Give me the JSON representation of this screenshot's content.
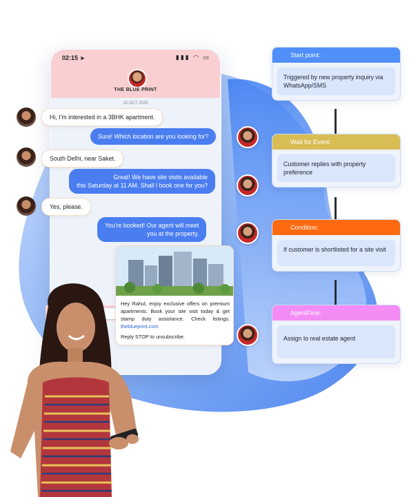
{
  "phone": {
    "time": "02:15",
    "brand": "THE BLUE PRINT",
    "date": "02 OCT 2025",
    "input_placeholder": "ssage"
  },
  "messages": [
    {
      "from": "customer",
      "text": "Hi, I'm interested in a 3BHK apartment."
    },
    {
      "from": "agent",
      "text": "Sure! Which location are you looking for?"
    },
    {
      "from": "customer",
      "text": "South Delhi, near Saket."
    },
    {
      "from": "agent",
      "line1": "Great! We have site visits available",
      "line2": "this Saturday at 11 AM. Shall I book one for you?"
    },
    {
      "from": "customer",
      "text": "Yes, please."
    },
    {
      "from": "agent",
      "line1": "You're booked! Our agent will meet",
      "line2": "you at the property."
    }
  ],
  "promo": {
    "body": "Hey Rahul, enjoy exclusive offers on premium apartments. Book your site visit today & get stamp duty assistance. Check listings: ",
    "link": "theblueprint.com",
    "footer": "Reply STOP to unsubscribe."
  },
  "flow": [
    {
      "title": "Start point:",
      "body": "Triggered by new property inquiry via WhatsApp/SMS",
      "color": "#4f8ff7"
    },
    {
      "title": "Wait for Event:",
      "body": "Customer replies with property preference",
      "color": "#d8bd55"
    },
    {
      "title": "Condition:",
      "body": "If customer is shortlisted for a site visit",
      "color": "#ff6a10"
    },
    {
      "title": "AgentFlow:",
      "body": "Assign to real estate agent",
      "color": "#f48cf6"
    }
  ],
  "colors": {
    "accent_blue": "#4a7df0",
    "header_pink": "#f9cfd2"
  }
}
